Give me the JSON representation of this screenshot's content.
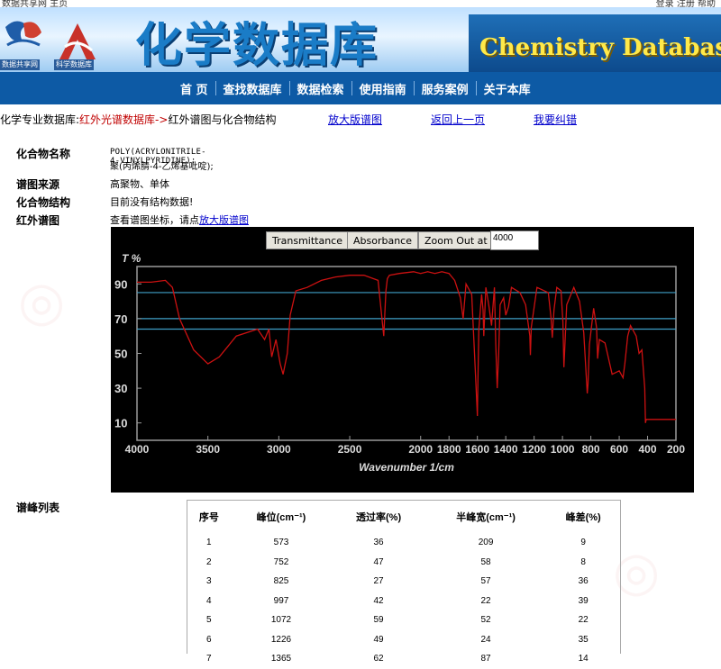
{
  "top": {
    "left_text": "数据共享网 主页",
    "right_text": "登录 注册 帮助"
  },
  "banner": {
    "logo1_caption": "数据共享网",
    "logo2_caption": "科学数据库",
    "title_cn": "化学数据库",
    "title_en": "Chemistry Database"
  },
  "nav": {
    "items": [
      "首 页",
      "查找数据库",
      "数据检索",
      "使用指南",
      "服务案例",
      "关于本库"
    ]
  },
  "breadcrumb": {
    "prefix": "化学专业数据库:",
    "link": "红外光谱数据库->",
    "current": "红外谱图与化合物结构",
    "links": [
      "放大版谱图",
      "返回上一页",
      "我要纠错"
    ]
  },
  "compound": {
    "name_label": "化合物名称",
    "name_en": "POLY(ACRYLONITRILE-4-VINYLPYRIDINE);",
    "name_cn": "聚(丙烯腈-4-乙烯基吡啶);",
    "source_label": "谱图来源",
    "source": "高聚物、单体",
    "structure_label": "化合物结构",
    "structure": "目前没有结构数据!",
    "ir_label": "红外谱图",
    "ir_hint": "查看谱图坐标，请点",
    "ir_link": "放大版谱图"
  },
  "spectrum_controls": {
    "transmittance": "Transmittance",
    "absorbance": "Absorbance",
    "zoom_out": "Zoom Out at",
    "zoom_value": "4000"
  },
  "colors": {
    "trace": "#cc1111",
    "ref_lines": "#3fa0c8",
    "axis": "#9a9a9a",
    "nav": "#0d5aa5"
  },
  "chart_data": {
    "type": "line",
    "ylabel": "T %",
    "xlabel": "Wavenumber 1/cm",
    "xlim": [
      4000,
      200
    ],
    "ylim": [
      0,
      100
    ],
    "x_ticks": [
      4000,
      3500,
      3000,
      2500,
      2000,
      1800,
      1600,
      1400,
      1200,
      1000,
      800,
      600,
      400,
      200
    ],
    "y_ticks": [
      10,
      30,
      50,
      70,
      90
    ],
    "reference_lines": [
      85,
      70,
      64
    ],
    "series": [
      {
        "x": [
          4000,
          3900,
          3800,
          3750,
          3700,
          3600,
          3500,
          3420,
          3300,
          3150,
          3100,
          3070,
          3050,
          3020,
          2990,
          2970,
          2940,
          2920,
          2880,
          2800,
          2700,
          2600,
          2500,
          2400,
          2300,
          2260,
          2245,
          2235,
          2220,
          2150,
          2050,
          2000,
          1950,
          1900,
          1850,
          1800,
          1760,
          1720,
          1700,
          1680,
          1640,
          1620,
          1600,
          1597,
          1590,
          1570,
          1560,
          1555,
          1540,
          1520,
          1500,
          1480,
          1470,
          1460,
          1450,
          1440,
          1415,
          1400,
          1380,
          1360,
          1300,
          1260,
          1230,
          1226,
          1220,
          1180,
          1100,
          1080,
          1072,
          1060,
          1040,
          1010,
          997,
          990,
          970,
          920,
          880,
          850,
          825,
          820,
          810,
          780,
          760,
          752,
          740,
          700,
          650,
          600,
          573,
          560,
          540,
          520,
          480,
          460,
          440,
          420,
          415,
          410,
          400,
          300,
          200
        ],
        "y": [
          91,
          91,
          92,
          88,
          70,
          52,
          44,
          48,
          60,
          64,
          58,
          64,
          48,
          58,
          44,
          38,
          50,
          72,
          86,
          88,
          92,
          94,
          95,
          95,
          92,
          60,
          86,
          93,
          95,
          96,
          97,
          96,
          97,
          96,
          97,
          96,
          92,
          82,
          70,
          90,
          84,
          50,
          14,
          32,
          64,
          84,
          75,
          60,
          88,
          78,
          66,
          88,
          55,
          30,
          50,
          78,
          82,
          72,
          77,
          88,
          85,
          78,
          60,
          49,
          65,
          88,
          85,
          70,
          59,
          75,
          88,
          86,
          68,
          42,
          78,
          88,
          80,
          62,
          27,
          32,
          55,
          76,
          65,
          47,
          58,
          56,
          38,
          40,
          36,
          44,
          60,
          66,
          60,
          50,
          52,
          30,
          10,
          12,
          12,
          12,
          12
        ]
      }
    ]
  },
  "peaks_table": {
    "label": "谱峰列表",
    "headers": [
      "序号",
      "峰位(cm⁻¹)",
      "透过率(%)",
      "半峰宽(cm⁻¹)",
      "峰差(%)"
    ],
    "rows": [
      [
        "1",
        "573",
        "36",
        "209",
        "9"
      ],
      [
        "2",
        "752",
        "47",
        "58",
        "8"
      ],
      [
        "3",
        "825",
        "27",
        "57",
        "36"
      ],
      [
        "4",
        "997",
        "42",
        "22",
        "39"
      ],
      [
        "5",
        "1072",
        "59",
        "52",
        "22"
      ],
      [
        "6",
        "1226",
        "49",
        "24",
        "35"
      ],
      [
        "7",
        "1365",
        "62",
        "87",
        "14"
      ]
    ]
  }
}
